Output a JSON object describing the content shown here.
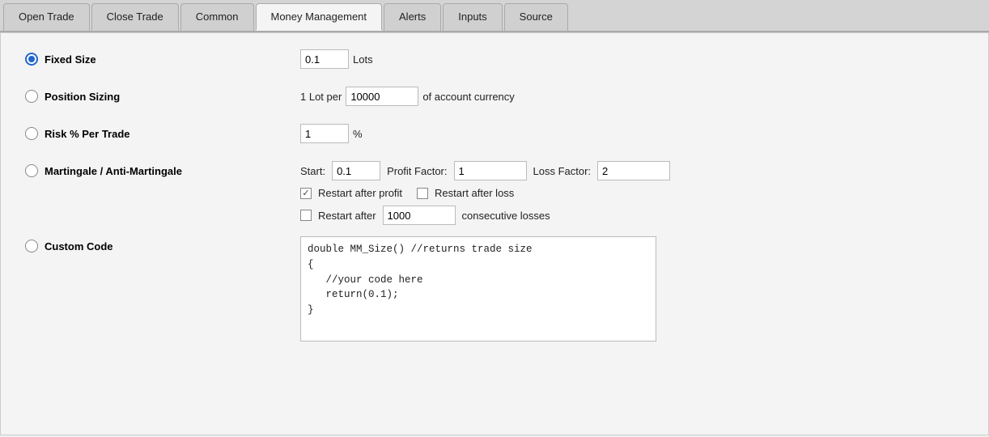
{
  "tabs": [
    {
      "id": "open-trade",
      "label": "Open Trade",
      "active": false
    },
    {
      "id": "close-trade",
      "label": "Close Trade",
      "active": false
    },
    {
      "id": "common",
      "label": "Common",
      "active": false
    },
    {
      "id": "money-management",
      "label": "Money Management",
      "active": true
    },
    {
      "id": "alerts",
      "label": "Alerts",
      "active": false
    },
    {
      "id": "inputs",
      "label": "Inputs",
      "active": false
    },
    {
      "id": "source",
      "label": "Source",
      "active": false
    }
  ],
  "rows": {
    "fixed_size": {
      "label": "Fixed Size",
      "input_value": "0.1",
      "suffix": "Lots",
      "selected": true
    },
    "position_sizing": {
      "label": "Position Sizing",
      "prefix": "1 Lot per",
      "input_value": "10000",
      "suffix": "of account currency",
      "selected": false
    },
    "risk_per_trade": {
      "label": "Risk % Per Trade",
      "input_value": "1",
      "suffix": "%",
      "selected": false
    },
    "martingale": {
      "label": "Martingale / Anti-Martingale",
      "selected": false,
      "start_label": "Start:",
      "start_value": "0.1",
      "profit_factor_label": "Profit Factor:",
      "profit_factor_value": "1",
      "loss_factor_label": "Loss Factor:",
      "loss_factor_value": "2",
      "restart_profit_label": "Restart after profit",
      "restart_profit_checked": true,
      "restart_loss_label": "Restart after loss",
      "restart_loss_checked": false,
      "restart_consecutive_label_pre": "Restart after",
      "restart_consecutive_value": "1000",
      "restart_consecutive_label_post": "consecutive losses",
      "restart_consecutive_checked": false
    },
    "custom_code": {
      "label": "Custom Code",
      "selected": false,
      "code": "double MM_Size() //returns trade size\n{\n   //your code here\n   return(0.1);\n}"
    }
  }
}
